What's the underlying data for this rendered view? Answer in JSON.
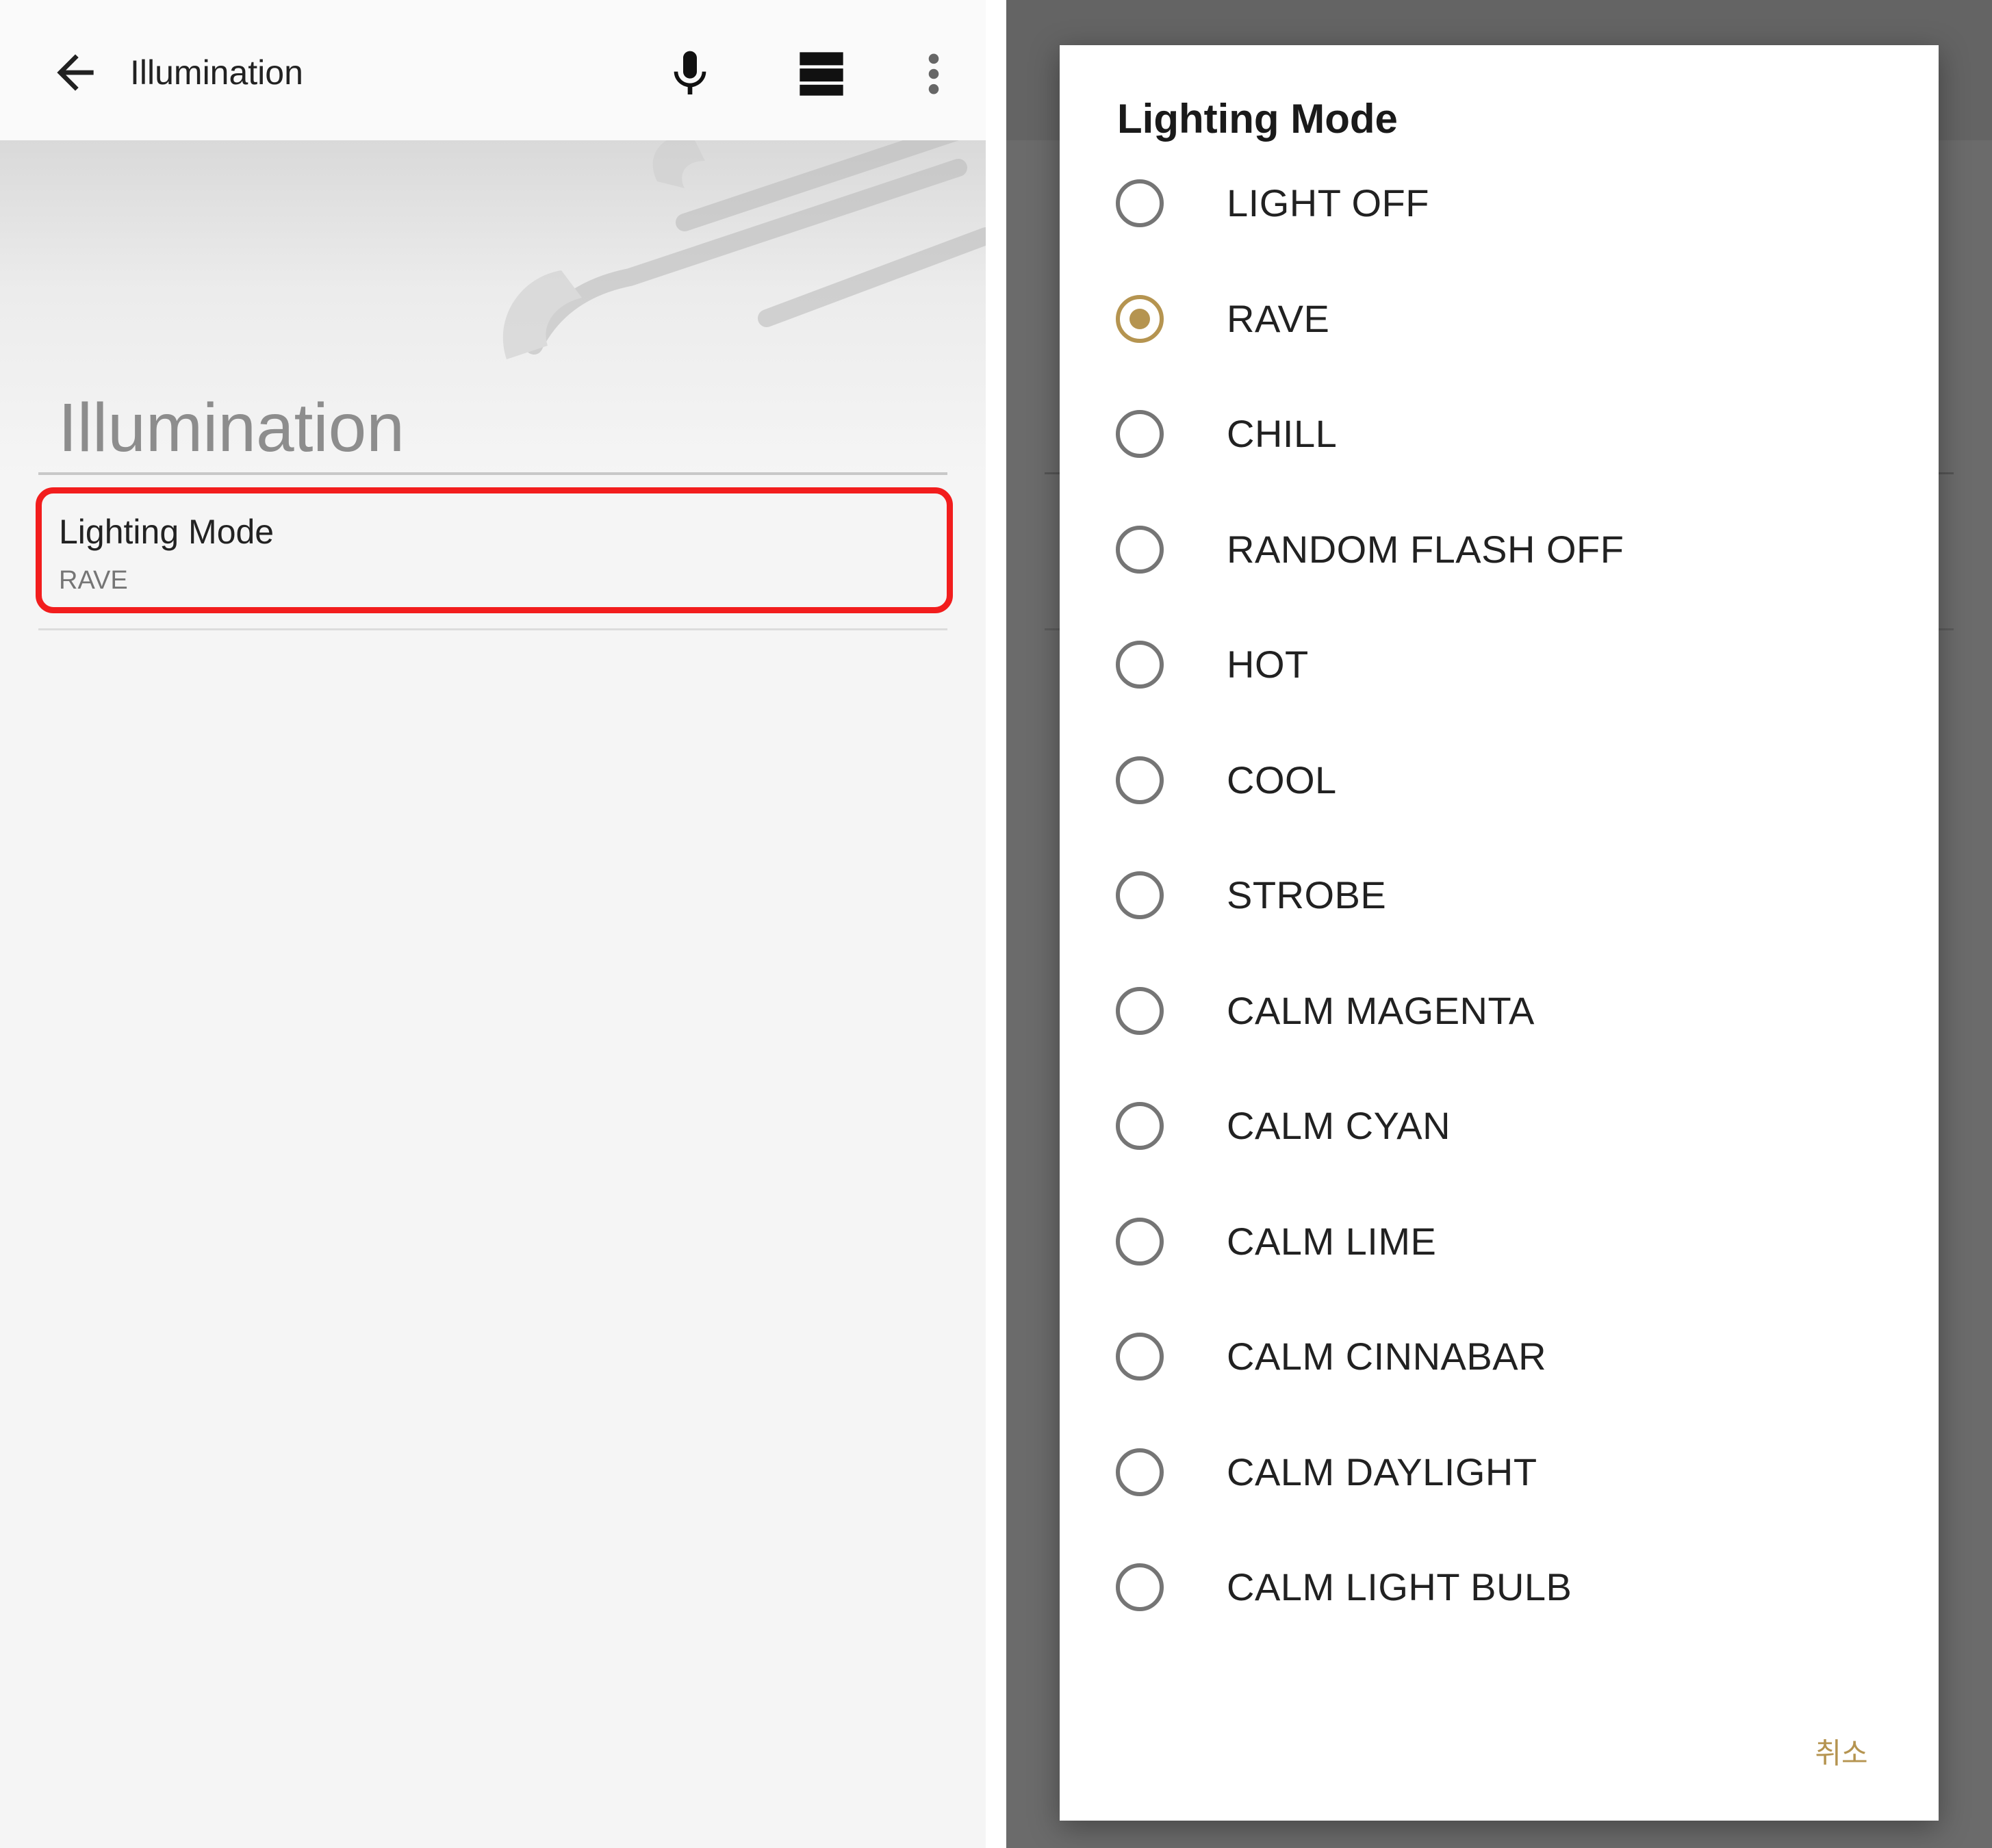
{
  "left_screen": {
    "appbar": {
      "title": "Illumination",
      "icons": [
        "back-arrow-icon",
        "microphone-icon",
        "view-toggle-icon",
        "more-vert-icon"
      ]
    },
    "header": {
      "title": "Illumination"
    },
    "preference": {
      "title": "Lighting Mode",
      "summary": "RAVE"
    },
    "highlight_color": "#f21d1d"
  },
  "dialog": {
    "title": "Lighting Mode",
    "options": [
      {
        "label": "LIGHT OFF",
        "selected": false
      },
      {
        "label": "RAVE",
        "selected": true
      },
      {
        "label": "CHILL",
        "selected": false
      },
      {
        "label": "RANDOM FLASH OFF",
        "selected": false
      },
      {
        "label": "HOT",
        "selected": false
      },
      {
        "label": "COOL",
        "selected": false
      },
      {
        "label": "STROBE",
        "selected": false
      },
      {
        "label": "CALM MAGENTA",
        "selected": false
      },
      {
        "label": "CALM CYAN",
        "selected": false
      },
      {
        "label": "CALM LIME",
        "selected": false
      },
      {
        "label": "CALM CINNABAR",
        "selected": false
      },
      {
        "label": "CALM DAYLIGHT",
        "selected": false
      },
      {
        "label": "CALM LIGHT BULB",
        "selected": false
      }
    ],
    "cancel_label": "취소",
    "accent_color": "#b59450"
  }
}
